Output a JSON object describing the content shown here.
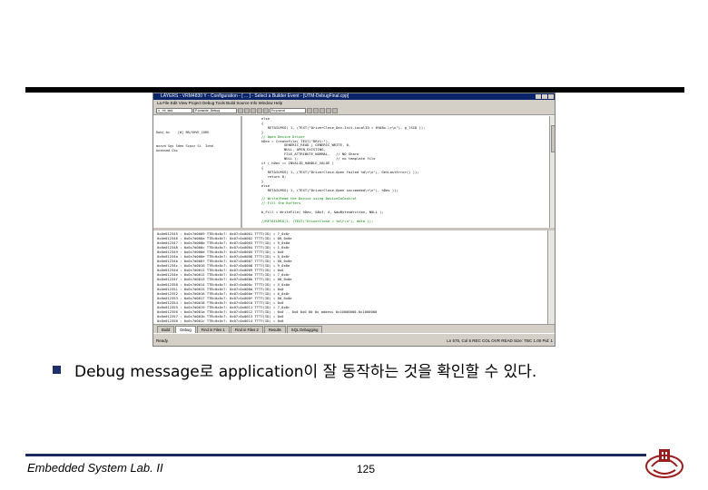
{
  "window": {
    "title": "LAYERS - VRM4830 Y - Configuration - [ ... ] - Select a Builder Event - [UTM-DebugFinal.cpp]",
    "menu": "La File  Edit  View  Project  Debug  Tools  Build  Source  Info  Window  Help"
  },
  "toolbar": {
    "combo1": "Evynand",
    "combo2": "x_rd_bmi",
    "combo3": "Pinmode_Debug"
  },
  "left_pane": "Dobj.bc    [W] BR/SHVE_CORE\n\n\nmxxvd Sgs Sdeo Scpxz Si  Icmd\nAndonad Cbc\n",
  "code_lines": [
    "   else",
    "   {",
    "      RETAILMSG( 1, (TEXT(\"DriverClose_Dev.Init.LocalIO = 0%08x.\\r\\n\"), g_lSID ));",
    "   }",
    "   // Open Device Driver",
    "   hDev = CreateFile( TEXT(\"DRV1:\"),",
    "              GENERIC_READ | GENERIC_WRITE, 0,",
    "              NULL, OPEN_EXISTING,",
    "              FILE_ATTRIBUTE_NORMAL,   // NO Share",
    "              NULL );                  // no template file",
    "   if ( hDev == INVALID_HANDLE_VALUE )",
    "   {",
    "      RETAILMSG( 1, (TEXT(\"DriverClose.Open failed %d\\r\\n\"), GetLastError() ));",
    "      return 0;",
    "   }",
    "   else",
    "      RETAILMSG( 1, (TEXT(\"DriverClose.Open succeeded\\r\\n\"), hDev ));",
    "",
    "   // Write/Read the Device using DeviceIoControl",
    "   // Fill the Buffers",
    "",
    "   b_Fill = WriteFile( hDev, &Buf, 4, &dwBytesWritten, NULL );",
    "",
    "   //RETAILMSG(1, (TEXT(\"DriverClose = %d\\r\\n\"), data ));"
  ],
  "output_lines": [
    "0x6e012345 : 0x0c7d0009 TTB=0x0c7: 0x07=0x0001 TTTT(ID) = 7_0x0r",
    "0x6e012346 : 0x0c7d000a TTB=0x0c7: 0x07=0x0002 TTTT(ID) = 00_0x0e",
    "0x6e012347 : 0x0c7d000b TTB=0x0c7: 0x07=0x0003 TTTT(ID) = 9_0x0e",
    "0x6e012348 : 0x0c7d000c TTB=0x0c7: 0x07=0x0004 TTTT(ID) = 1_0x0r",
    "0x6e012349 : 0x0c7d000d TTB=0x0c7: 0x07=0x0005 TTTT(ID) = 0x0",
    "0x6e01234a : 0x0c7d000e TTB=0x0c7: 0x07=0x0006 TTTT(ID) = 5_0x0r",
    "0x6e01234b : 0x0c7d000f TTB=0x0c7: 0x07=0x0007 TTTT(ID) = 00_0x0e",
    "0x6e01234c : 0x0c7d0010 TTB=0x0c7: 0x07=0x0008 TTTT(ID) = 9_0x0e",
    "0x6e01234d : 0x0c7d0011 TTB=0x0c7: 0x07=0x0009 TTTT(ID) = 0x0",
    "0x6e01234e : 0x0c7d0012 TTB=0x0c7: 0x07=0x000a TTTT(ID) = 7_0x0r",
    "0x6e01234f : 0x0c7d0013 TTB=0x0c7: 0x07=0x000b TTTT(ID) = 00_0x0e",
    "0x6e012350 : 0x0c7d0014 TTB=0x0c7: 0x07=0x000c TTTT(ID) = 3_0x0e",
    "0x6e012351 : 0x0c7d0015 TTB=0x0c7: 0x07=0x000d TTTT(ID) = 0x0",
    "0x6e012352 : 0x0c7d0016 TTB=0x0c7: 0x07=0x000e TTTT(ID) = 6_0x0r",
    "0x6e012353 : 0x0c7d0017 TTB=0x0c7: 0x07=0x000f TTTT(ID) = 00_0x0e",
    "0x6e012354 : 0x0c7d0018 TTB=0x0c7: 0x07=0x0010 TTTT(ID) = 0x0",
    "0x6e012355 : 0x0c7d0019 TTB=0x0c7: 0x07=0x0011 TTTT(ID) = 7_0x0r",
    "0x6e012356 : 0x0c7d001a TTB=0x0c7: 0x07=0x0012 TTTT(ID) : 0x0 .. 0x0 0x0 00 0x addess 0x10000000.0x1000000",
    "0x6e012357 : 0x0c7d001b TTB=0x0c7: 0x07=0x0013 TTTT(ID) = 0x0",
    "0x6e012358 : 0x0c7d001c TTB=0x0c7: 0x07=0x0014 TTTT(ID) = 0x0"
  ],
  "tabs": [
    "Build",
    "Debug",
    "Find in Files 1",
    "Find in Files 2",
    "Results",
    "SQL Debugging"
  ],
  "status": {
    "left": "Ready",
    "right": "Ln 575, Col 5    REC  COL  OVR  READ    Size: TBC 1.00 Pid: 1"
  },
  "bullet_text": "Debug message로 application이 잘 동작하는 것을 확인할 수 있다.",
  "footer": {
    "left": "Embedded System Lab. II",
    "page": "125"
  },
  "colors": {
    "rule": "#000000",
    "bullet": "#1f2f6a",
    "footer_rule": "#1a2a5a",
    "logo": "#9b1c1c"
  }
}
